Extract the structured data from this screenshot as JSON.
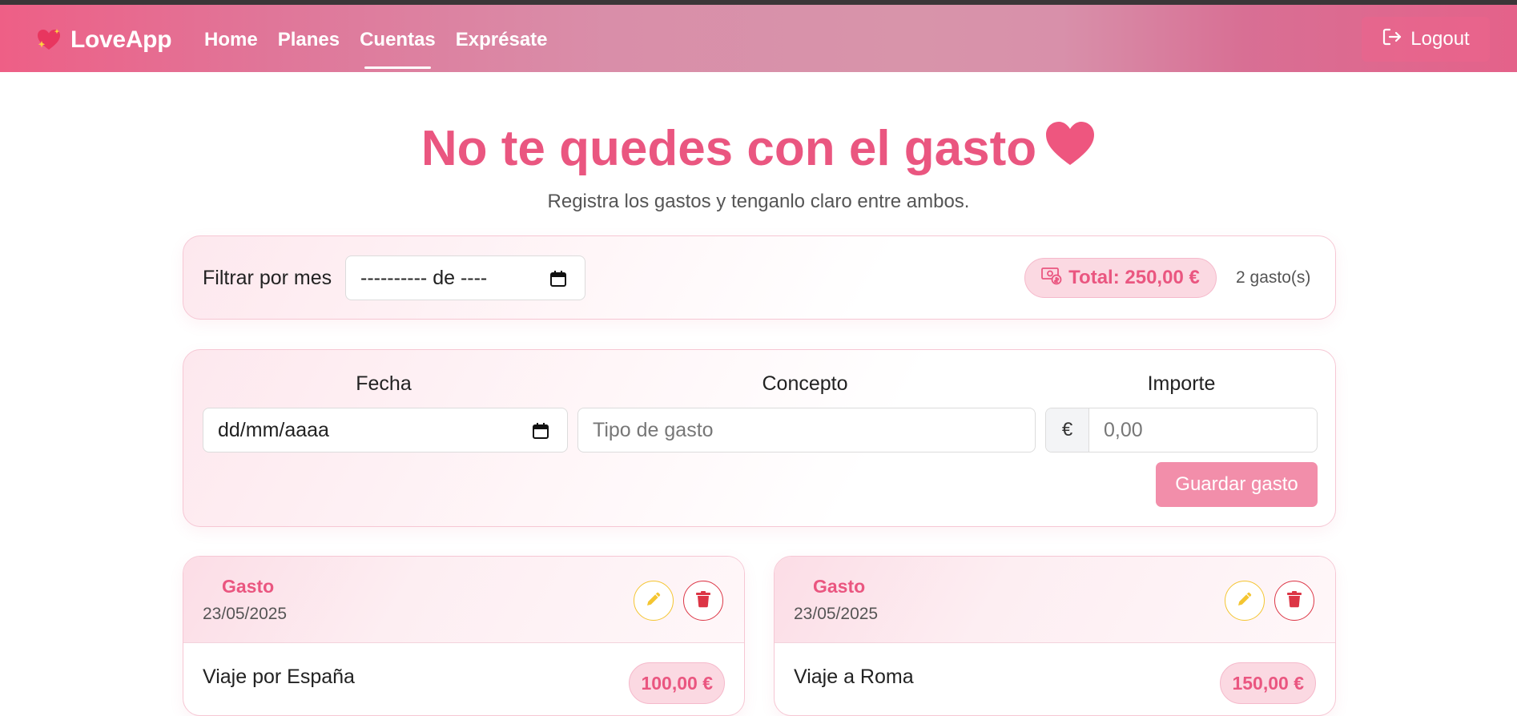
{
  "navbar": {
    "brand": "LoveApp",
    "links": [
      {
        "label": "Home"
      },
      {
        "label": "Planes"
      },
      {
        "label": "Cuentas"
      },
      {
        "label": "Exprésate"
      }
    ],
    "active_link": "Cuentas",
    "logout_label": "Logout"
  },
  "hero": {
    "title": "No te quedes con el gasto",
    "subtitle": "Registra los gastos y tenganlo claro entre ambos."
  },
  "filter": {
    "label": "Filtrar por mes",
    "month_value": "---------- de ----",
    "total_label": "Total: 250,00 €",
    "count_label": "2 gasto(s)"
  },
  "form": {
    "date_label": "Fecha",
    "date_placeholder": "dd/mm/aaaa",
    "concept_label": "Concepto",
    "concept_placeholder": "Tipo de gasto",
    "amount_label": "Importe",
    "currency_symbol": "€",
    "amount_placeholder": "0,00",
    "save_label": "Guardar gasto"
  },
  "expenses": [
    {
      "kind": "Gasto",
      "date": "23/05/2025",
      "concept": "Viaje por España",
      "amount": "100,00 €"
    },
    {
      "kind": "Gasto",
      "date": "23/05/2025",
      "concept": "Viaje a Roma",
      "amount": "150,00 €"
    }
  ],
  "colors": {
    "accent": "#ea5680",
    "nav_start": "#ee5f86",
    "nav_mid": "#d894aa",
    "save_button": "#f28eaa",
    "edit_border": "#f4c531",
    "delete_border": "#dc3545"
  },
  "icons": {
    "brand": "heart-sparkles-icon",
    "logout": "logout-icon",
    "hero": "heart-icon",
    "calendar": "calendar-icon",
    "total": "money-icon",
    "edit": "pencil-icon",
    "delete": "trash-icon"
  }
}
